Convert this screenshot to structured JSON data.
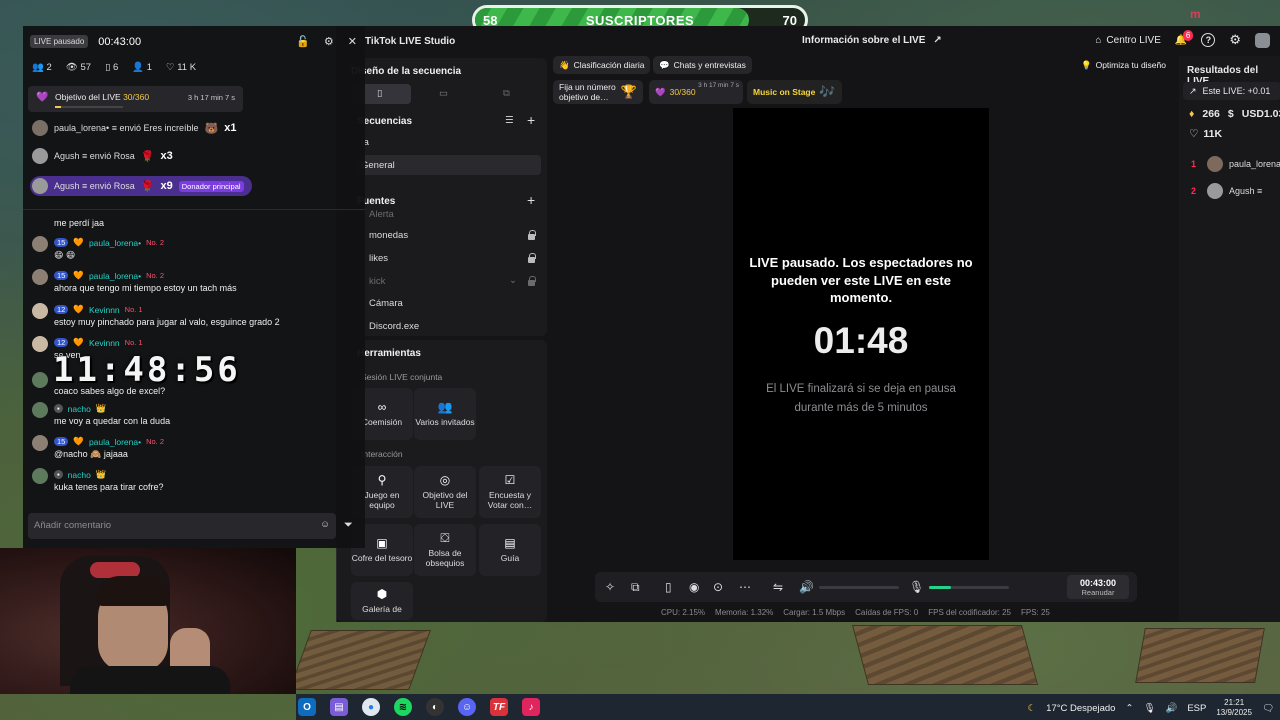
{
  "subscribers_goal": {
    "current": "58",
    "label": "SUSCRIPTORES",
    "target": "70",
    "progress_fraction": 0.83
  },
  "studio": {
    "app_title": "TikTok LIVE Studio",
    "info_title": "Información sobre el LIVE",
    "centro_live": "Centro LIVE",
    "notif_count": "6",
    "scene_design": "Diseño de la secuencia",
    "sequences": "Secuencias",
    "seq_items": [
      "ía",
      "General"
    ],
    "sources": "Fuentes",
    "source_items": [
      {
        "label": "Alerta",
        "dim": true
      },
      {
        "label": "monedas",
        "dim": false
      },
      {
        "label": "likes",
        "dim": false
      },
      {
        "label": "kick",
        "dim": true
      },
      {
        "label": "Cámara",
        "dim": false
      },
      {
        "label": "Discord.exe",
        "dim": false
      }
    ],
    "tools_title": "Herramientas",
    "joint_session": "Sesión LIVE conjunta",
    "tool_coemision": "Coemisión",
    "tool_invitados": "Varios invitados",
    "interaction": "Interacción",
    "tool_juego": "Juego en equipo",
    "tool_objetivo": "Objetivo del LIVE",
    "tool_encuesta": "Encuesta y Votar con…",
    "tool_cofre": "Cofre del tesoro",
    "tool_bolsa": "Bolsa de obsequios",
    "tool_guia": "Guía",
    "tool_galeria": "Galería de",
    "chip_clasificacion": "Clasificación diaria",
    "chip_chats": "Chats y entrevistas",
    "chip_optimiza": "Optimiza tu diseño",
    "chip_fija": "Fija un número objetivo de…",
    "chip_goal": "30/360",
    "chip_goal_time": "3 h 17 min 7 s",
    "chip_music": "Music on Stage",
    "paused_message": "LIVE pausado. Los espectadores no pueden ver este LIVE en este momento.",
    "paused_countdown": "01:48",
    "paused_note": "El LIVE finalizará si se deja en pausa durante más de 5 minutos",
    "stream_time": "00:43:00",
    "resume": "Reanudar",
    "mic_level": 0.28,
    "stats": [
      "CPU: 2.15%",
      "Memoria: 1.32%",
      "Cargar: 1.5 Mbps",
      "Caídas de FPS: 0",
      "FPS del codificador: 25",
      "FPS: 25"
    ],
    "results_title": "Resultados del LIVE",
    "results_delta": "Este LIVE: +0.01",
    "results_coins": "266",
    "results_usd": "USD1.03",
    "results_likes": "11K",
    "ranking": [
      {
        "rank": "1",
        "name": "paula_lorena"
      },
      {
        "rank": "2",
        "name": "Agush ≡"
      }
    ]
  },
  "chat": {
    "status_pill": "LIVE pausado",
    "time": "00:43:00",
    "stats": {
      "guests": "2",
      "viewers": "57",
      "gifts": "6",
      "followers": "1",
      "likes": "11 K"
    },
    "goal_label": "Objetivo del LIVE",
    "goal_value": "30/360",
    "goal_time": "3 h 17 min 7 s",
    "goal_fraction": 0.083,
    "gifts": [
      {
        "text": "paula_lorena• ≡ envió Eres increíble",
        "count": "x1",
        "highlight": false
      },
      {
        "text": "Agush ≡ envió Rosa",
        "count": "x3",
        "highlight": false
      },
      {
        "text": "Agush ≡ envió Rosa",
        "count": "x9",
        "highlight": true,
        "tag": "Donador principal"
      }
    ],
    "messages": [
      {
        "name": "",
        "level": "",
        "rank": "",
        "text": "me perdí jaa"
      },
      {
        "name": "paula_lorena•",
        "level": "15",
        "rank": "No. 2",
        "text": "😄 😄"
      },
      {
        "name": "paula_lorena•",
        "level": "15",
        "rank": "No. 2",
        "text": "ahora que tengo mi tiempo estoy un tach más"
      },
      {
        "name": "Kevinnn",
        "level": "12",
        "rank": "No. 1",
        "text": "estoy muy pinchado para jugar al valo, esguince grado 2"
      },
      {
        "name": "Kevinnn",
        "level": "12",
        "rank": "No. 1",
        "text": "se ven"
      },
      {
        "name": "",
        "level": "",
        "rank": "",
        "text": "coaco sabes algo de excel?"
      },
      {
        "name": "nacho",
        "level": "",
        "rank": "",
        "text": "me voy a quedar con la duda"
      },
      {
        "name": "paula_lorena•",
        "level": "15",
        "rank": "No. 2",
        "text": "@nacho 🙈 jajaaa"
      },
      {
        "name": "nacho",
        "level": "",
        "rank": "",
        "text": "kuka tenes para tirar cofre?"
      }
    ],
    "clock_overlay": "11:48:56",
    "comment_placeholder": "Añadir comentario"
  },
  "taskbar": {
    "weather": "17°C Despejado",
    "lang": "ESP",
    "time": "21:21",
    "date": "13/9/2025",
    "app_icons": [
      "outlook-icon",
      "files-icon",
      "chrome-icon",
      "spotify-icon",
      "obs-icon",
      "discord-icon",
      "tf-icon",
      "tiktok-icon"
    ]
  },
  "colors": {
    "tiktok_red": "#fe2c55",
    "teal_name": "#22d3c7",
    "goal_green": "#3fb84b",
    "mic_green": "#25d28a"
  }
}
